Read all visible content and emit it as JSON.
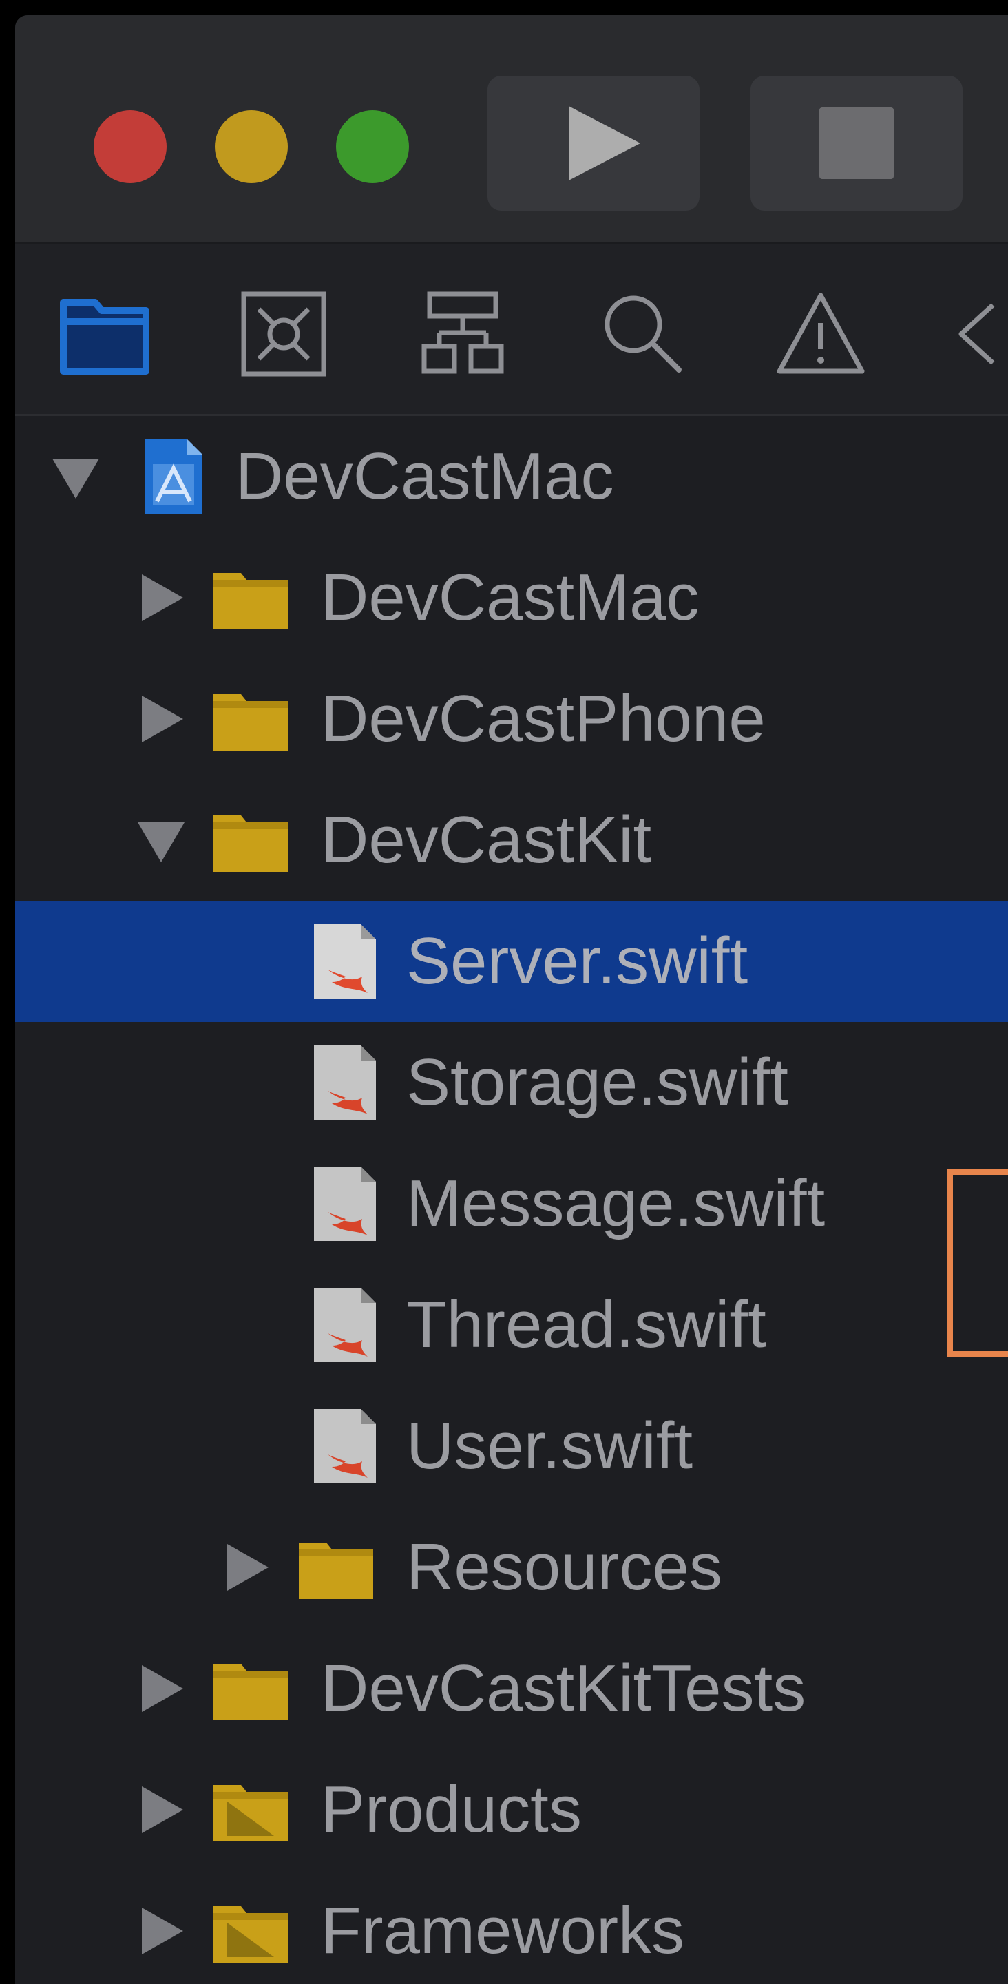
{
  "toolbar": {
    "traffic_lights": {
      "close_color": "#c33d38",
      "minimize_color": "#c19a1e",
      "zoom_color": "#3c9a2c"
    },
    "run_icon": "play-icon",
    "stop_icon": "stop-icon"
  },
  "navigator_tabs": [
    {
      "icon": "folder-icon",
      "selected": true
    },
    {
      "icon": "source-control-icon"
    },
    {
      "icon": "hierarchy-icon"
    },
    {
      "icon": "search-icon"
    },
    {
      "icon": "warning-icon"
    },
    {
      "icon": "tag-icon"
    }
  ],
  "tree": {
    "project": {
      "label": "DevCastMac",
      "icon": "xcode-project-icon",
      "expanded": true
    },
    "items": [
      {
        "label": "DevCastMac",
        "icon": "folder-icon",
        "expanded": false
      },
      {
        "label": "DevCastPhone",
        "icon": "folder-icon",
        "expanded": false
      },
      {
        "label": "DevCastKit",
        "icon": "folder-icon",
        "expanded": true
      },
      {
        "label": "Server.swift",
        "icon": "swift-file-icon",
        "selected": true
      },
      {
        "label": "Storage.swift",
        "icon": "swift-file-icon"
      },
      {
        "label": "Message.swift",
        "icon": "swift-file-icon"
      },
      {
        "label": "Thread.swift",
        "icon": "swift-file-icon"
      },
      {
        "label": "User.swift",
        "icon": "swift-file-icon"
      },
      {
        "label": "Resources",
        "icon": "folder-icon",
        "expanded": false
      },
      {
        "label": "DevCastKitTests",
        "icon": "folder-icon",
        "expanded": false
      },
      {
        "label": "Products",
        "icon": "folder-icon",
        "expanded": false
      },
      {
        "label": "Frameworks",
        "icon": "folder-icon",
        "expanded": false
      }
    ]
  },
  "colors": {
    "selection": "#0f3a8e",
    "folder": "#c9a018",
    "accent_blue": "#1f6fd0",
    "highlight_bracket": "#e8854c"
  }
}
